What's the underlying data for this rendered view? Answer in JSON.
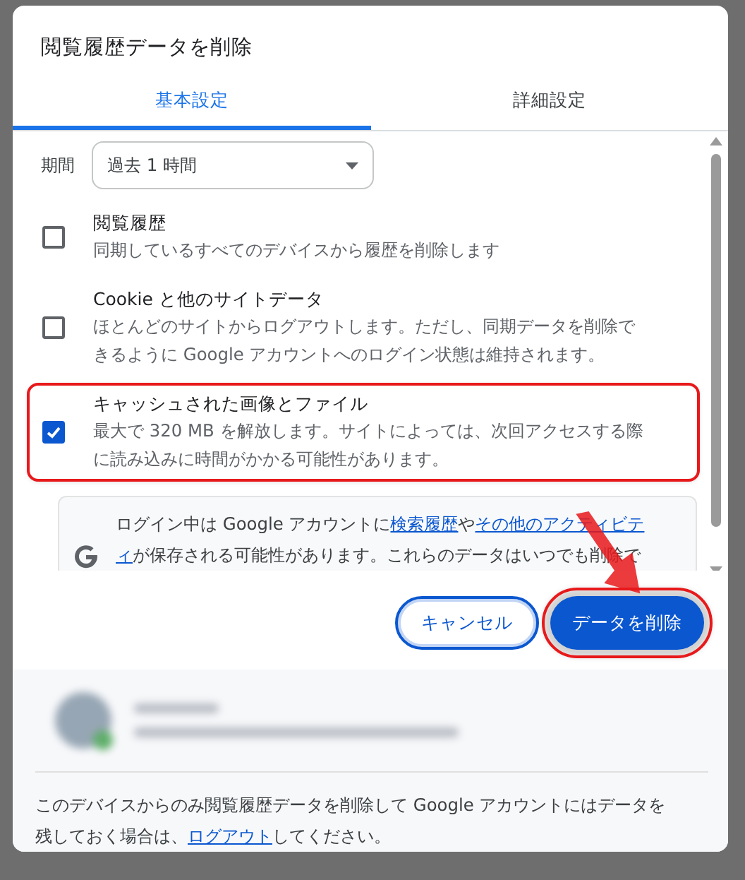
{
  "dialog": {
    "title": "閲覧履歴データを削除"
  },
  "tabs": [
    {
      "label": "基本設定",
      "selected": true
    },
    {
      "label": "詳細設定",
      "selected": false
    }
  ],
  "period": {
    "label": "期間",
    "value": "過去 1 時間"
  },
  "items": [
    {
      "title": "閲覧履歴",
      "description": [
        "同期しているすべてのデバイスから履歴を削除します"
      ],
      "checked": false,
      "highlighted": false
    },
    {
      "title": "Cookie と他のサイトデータ",
      "description": [
        "ほとんどのサイトからログアウトします。ただし、同期データを削除で",
        "きるように Google アカウントへのログイン状態は維持されます。"
      ],
      "checked": false,
      "highlighted": false
    },
    {
      "title": "キャッシュされた画像とファイル",
      "description": [
        "最大で 320 MB を解放します。サイトによっては、次回アクセスする際",
        "に読み込みに時間がかかる可能性があります。"
      ],
      "checked": true,
      "highlighted": true
    }
  ],
  "info": {
    "lines": [
      [
        {
          "text": "ログイン中は Google アカウントに",
          "kind": "text"
        },
        {
          "text": "検索履歴",
          "kind": "link"
        },
        {
          "text": "や",
          "kind": "text"
        },
        {
          "text": "その他のアクティビテ",
          "kind": "link"
        }
      ],
      [
        {
          "text": "ィ",
          "kind": "link"
        },
        {
          "text": "が保存される可能性があります。これらのデータはいつでも削除で",
          "kind": "text"
        }
      ]
    ]
  },
  "buttons": [
    {
      "label": "キャンセル",
      "kind": "outline",
      "highlighted": false
    },
    {
      "label": "データを削除",
      "kind": "primary",
      "highlighted": true
    }
  ],
  "annotation_arrow": true,
  "account": {
    "blurred": true
  },
  "footer": {
    "lines": [
      [
        {
          "text": "このデバイスからのみ閲覧履歴データを削除して Google アカウントにはデータを",
          "kind": "text"
        }
      ],
      [
        {
          "text": "残しておく場合は、",
          "kind": "text"
        },
        {
          "text": "ログアウト",
          "kind": "link"
        },
        {
          "text": "してください。",
          "kind": "text"
        }
      ]
    ]
  }
}
